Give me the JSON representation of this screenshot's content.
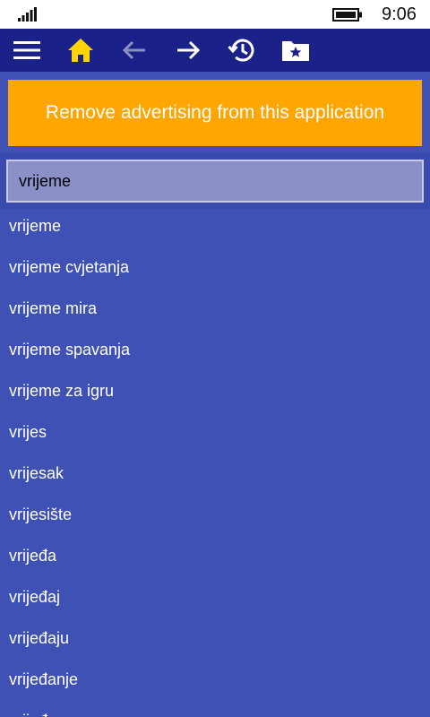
{
  "status_bar": {
    "time": "9:06",
    "icons": [
      "signal-icon",
      "battery-icon"
    ]
  },
  "app_bar": {
    "buttons": [
      "menu-icon",
      "home-icon",
      "back-arrow-icon",
      "forward-arrow-icon",
      "history-icon",
      "favorites-folder-icon"
    ],
    "colors": {
      "background": "#1a2188",
      "home": "#ffd400",
      "active": "#ffffff",
      "disabled": "#8c90c4"
    }
  },
  "ad": {
    "text": "Remove advertising from this application",
    "color": "#ffa500"
  },
  "search": {
    "value": "vrijeme"
  },
  "results": [
    "vrijeme",
    "vrijeme cvjetanja",
    "vrijeme mira",
    "vrijeme spavanja",
    "vrijeme za igru",
    "vrijes",
    "vrijesak",
    "vrijesište",
    "vrijeđa",
    "vrijeđaj",
    "vrijeđaju",
    "vrijeđanje",
    "vrijeđam"
  ]
}
